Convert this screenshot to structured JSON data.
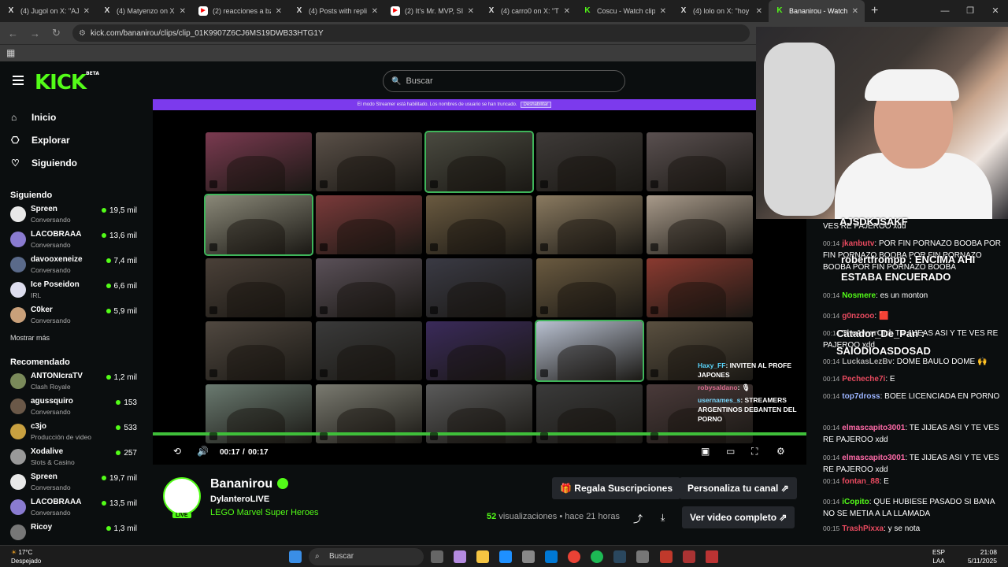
{
  "tabs": [
    {
      "label": "(4) Jugol on X: \"AJAJ",
      "icon": "x-icon"
    },
    {
      "label": "(4) Matyenzo on X: \"e",
      "icon": "x-icon"
    },
    {
      "label": "(2) reacciones a bzrp",
      "icon": "youtube-icon"
    },
    {
      "label": "(4) Posts with replies",
      "icon": "x-icon"
    },
    {
      "label": "(2) It's Mr. MVP, SIMI",
      "icon": "youtube-icon"
    },
    {
      "label": "(4) carro0 on X: \"Tratu",
      "icon": "x-icon"
    },
    {
      "label": "Coscu - Watch clips o",
      "icon": "kick-icon"
    },
    {
      "label": "(4) lolo on X: \"hoy de",
      "icon": "x-icon"
    },
    {
      "label": "Bananirou - Watch c",
      "icon": "kick-icon"
    }
  ],
  "address": {
    "url": "kick.com/bananirou/clips/clip_01K9907Z6CJ6MS19DWB33HTG1Y"
  },
  "header": {
    "logo": "KICK",
    "logo_badge": "BETA",
    "search_placeholder": "Buscar"
  },
  "nav": [
    {
      "label": "Inicio",
      "icon": "home-icon"
    },
    {
      "label": "Explorar",
      "icon": "compass-icon"
    },
    {
      "label": "Siguiendo",
      "icon": "heart-icon"
    }
  ],
  "following": {
    "title": "Siguiendo",
    "channels": [
      {
        "name": "Spreen",
        "category": "Conversando",
        "viewers": "19,5 mil",
        "color": "#e8e8e8"
      },
      {
        "name": "LACOBRAAA",
        "category": "Conversando",
        "viewers": "13,6 mil",
        "color": "#8a7bd0"
      },
      {
        "name": "davooxeneize",
        "category": "Conversando",
        "viewers": "7,4 mil",
        "color": "#5a6a8a"
      },
      {
        "name": "Ice Poseidon",
        "category": "IRL",
        "viewers": "6,6 mil",
        "color": "#dde"
      },
      {
        "name": "C0ker",
        "category": "Conversando",
        "viewers": "5,9 mil",
        "color": "#c9a07a"
      }
    ],
    "show_more": "Mostrar más"
  },
  "recommended": {
    "title": "Recomendado",
    "channels": [
      {
        "name": "ANTONIcraTV",
        "category": "Clash Royale",
        "viewers": "1,2 mil",
        "color": "#7a8a5a"
      },
      {
        "name": "agussquiro",
        "category": "Conversando",
        "viewers": "153",
        "color": "#6a5848"
      },
      {
        "name": "c3jo",
        "category": "Producción de video",
        "viewers": "533",
        "color": "#c8a040"
      },
      {
        "name": "Xodalive",
        "category": "Slots & Casino",
        "viewers": "257",
        "color": "#999"
      },
      {
        "name": "Spreen",
        "category": "Conversando",
        "viewers": "19,7 mil",
        "color": "#e8e8e8"
      },
      {
        "name": "LACOBRAAA",
        "category": "Conversando",
        "viewers": "13,5 mil",
        "color": "#8a7bd0"
      },
      {
        "name": "Ricoy",
        "category": "",
        "viewers": "1,3 mil",
        "color": "#777"
      }
    ]
  },
  "banner": {
    "text": "El modo Streamer está habilitado. Los nombres de usuario se han truncado.",
    "button": "Deshabilitar"
  },
  "video_grid": {
    "cell_colors": [
      "#7a3a50",
      "#5a5048",
      "#4a4a40",
      "#3e3a38",
      "#5a5050",
      "#8a8878",
      "#7a3a3a",
      "#6a5a40",
      "#8a7a60",
      "#a89a8a",
      "#4a4038",
      "#5a5058",
      "#3a3a44",
      "#6a5a40",
      "#8a3a30",
      "#504840",
      "#3a3a3a",
      "#3a2a5a",
      "#b8c0d0",
      "#5a5040",
      "#6a7a70",
      "#7a7a70",
      "#5a5a5a",
      "#3a3a3a",
      "#4a3a3a"
    ],
    "highlighted": [
      2,
      5,
      18
    ]
  },
  "overlay_chat": [
    {
      "user": "Haxy_FF",
      "text": ": INVITEN AL PROFE JAPONES"
    },
    {
      "user": "robysaldano",
      "text": ": 🎙"
    },
    {
      "user": "usernames_s",
      "text": ": STREAMERS ARGENTINOS DEBANTEN DEL PORNO"
    }
  ],
  "player": {
    "current_time": "00:17",
    "separator": "/",
    "duration": "00:17",
    "progress": 1.0
  },
  "chat": [
    {
      "ts": "",
      "user": "",
      "text": "VES RE PAJEROO xdd",
      "color": "#fff"
    },
    {
      "ts": "00:14",
      "user": "jkanbutv",
      "text": ": POR FIN PORNAZO BOOBA POR FIN PORNAZO BOOBA POR FIN PORNAZO BOOBA POR FIN PORNAZO BOOBA",
      "color": "#e84a5f"
    },
    {
      "ts": "00:14",
      "user": "Nosmere",
      "text": ": es un monton",
      "color": "#53fc18"
    },
    {
      "ts": "00:14",
      "user": "g0nzooo",
      "text": ": 🟥",
      "color": "#e84a5f"
    },
    {
      "ts": "00:14",
      "user": "TheAwwrOrd",
      "text": ": TE JIJEAS ASI Y TE VES RE PAJEROO xdd",
      "color": "#ccc"
    },
    {
      "ts": "00:14",
      "user": "LuckasLezBv",
      "text": ": DOME BAULO DOME 🙌",
      "color": "#aaa"
    },
    {
      "ts": "00:14",
      "user": "Pecheche7i",
      "text": ": E",
      "color": "#e84a5f"
    },
    {
      "ts": "00:14",
      "user": "top7dross",
      "text": ": BOEE LICENCIADA EN PORNO",
      "color": "#9bb4ff"
    },
    {
      "ts": "00:14",
      "user": "elmascapito3001",
      "text": ": TE JIJEAS ASI Y TE VES RE PAJEROO xdd",
      "color": "#ff6aa8"
    },
    {
      "ts": "00:14",
      "user": "elmascapito3001",
      "text": ": TE JIJEAS ASI Y TE VES RE PAJEROO xdd",
      "color": "#ff6aa8"
    },
    {
      "ts": "00:14",
      "user": "fontan_88",
      "text": ": E",
      "color": "#e84a5f"
    },
    {
      "ts": "00:14",
      "user": "iCopito",
      "text": ": QUE HUBIESE PASADO SI BANA NO SE METIA A LA LLAMADA",
      "color": "#53fc18"
    },
    {
      "ts": "00:15",
      "user": "TrashPixxa",
      "text": ": y se nota",
      "color": "#e84a5f"
    }
  ],
  "chat_overlay_big": [
    {
      "text": "AJSDKJSAKF"
    },
    {
      "text": "robertfrompp : ENCIMA AHI"
    },
    {
      "text": "ESTABA ENCUERADO"
    },
    {
      "text": "Catador_De_Pan :"
    },
    {
      "text": "SAIODIOASDOSAD"
    }
  ],
  "channel": {
    "name": "Bananirou",
    "live_badge": "LIVE",
    "clipper": "DylanteroLIVE",
    "game": "LEGO Marvel Super Heroes",
    "views": "52",
    "views_label": "visualizaciones",
    "dot": "•",
    "age": "hace 21 horas",
    "gift_button": "Regala Suscripciones",
    "customize_button": "Personaliza tu canal",
    "full_video_button": "Ver video completo"
  },
  "taskbar": {
    "temp": "17°C",
    "weather": "Despejado",
    "search": "Buscar",
    "lang1": "ESP",
    "lang2": "LAA",
    "time": "21:08",
    "date": "5/11/2025"
  }
}
